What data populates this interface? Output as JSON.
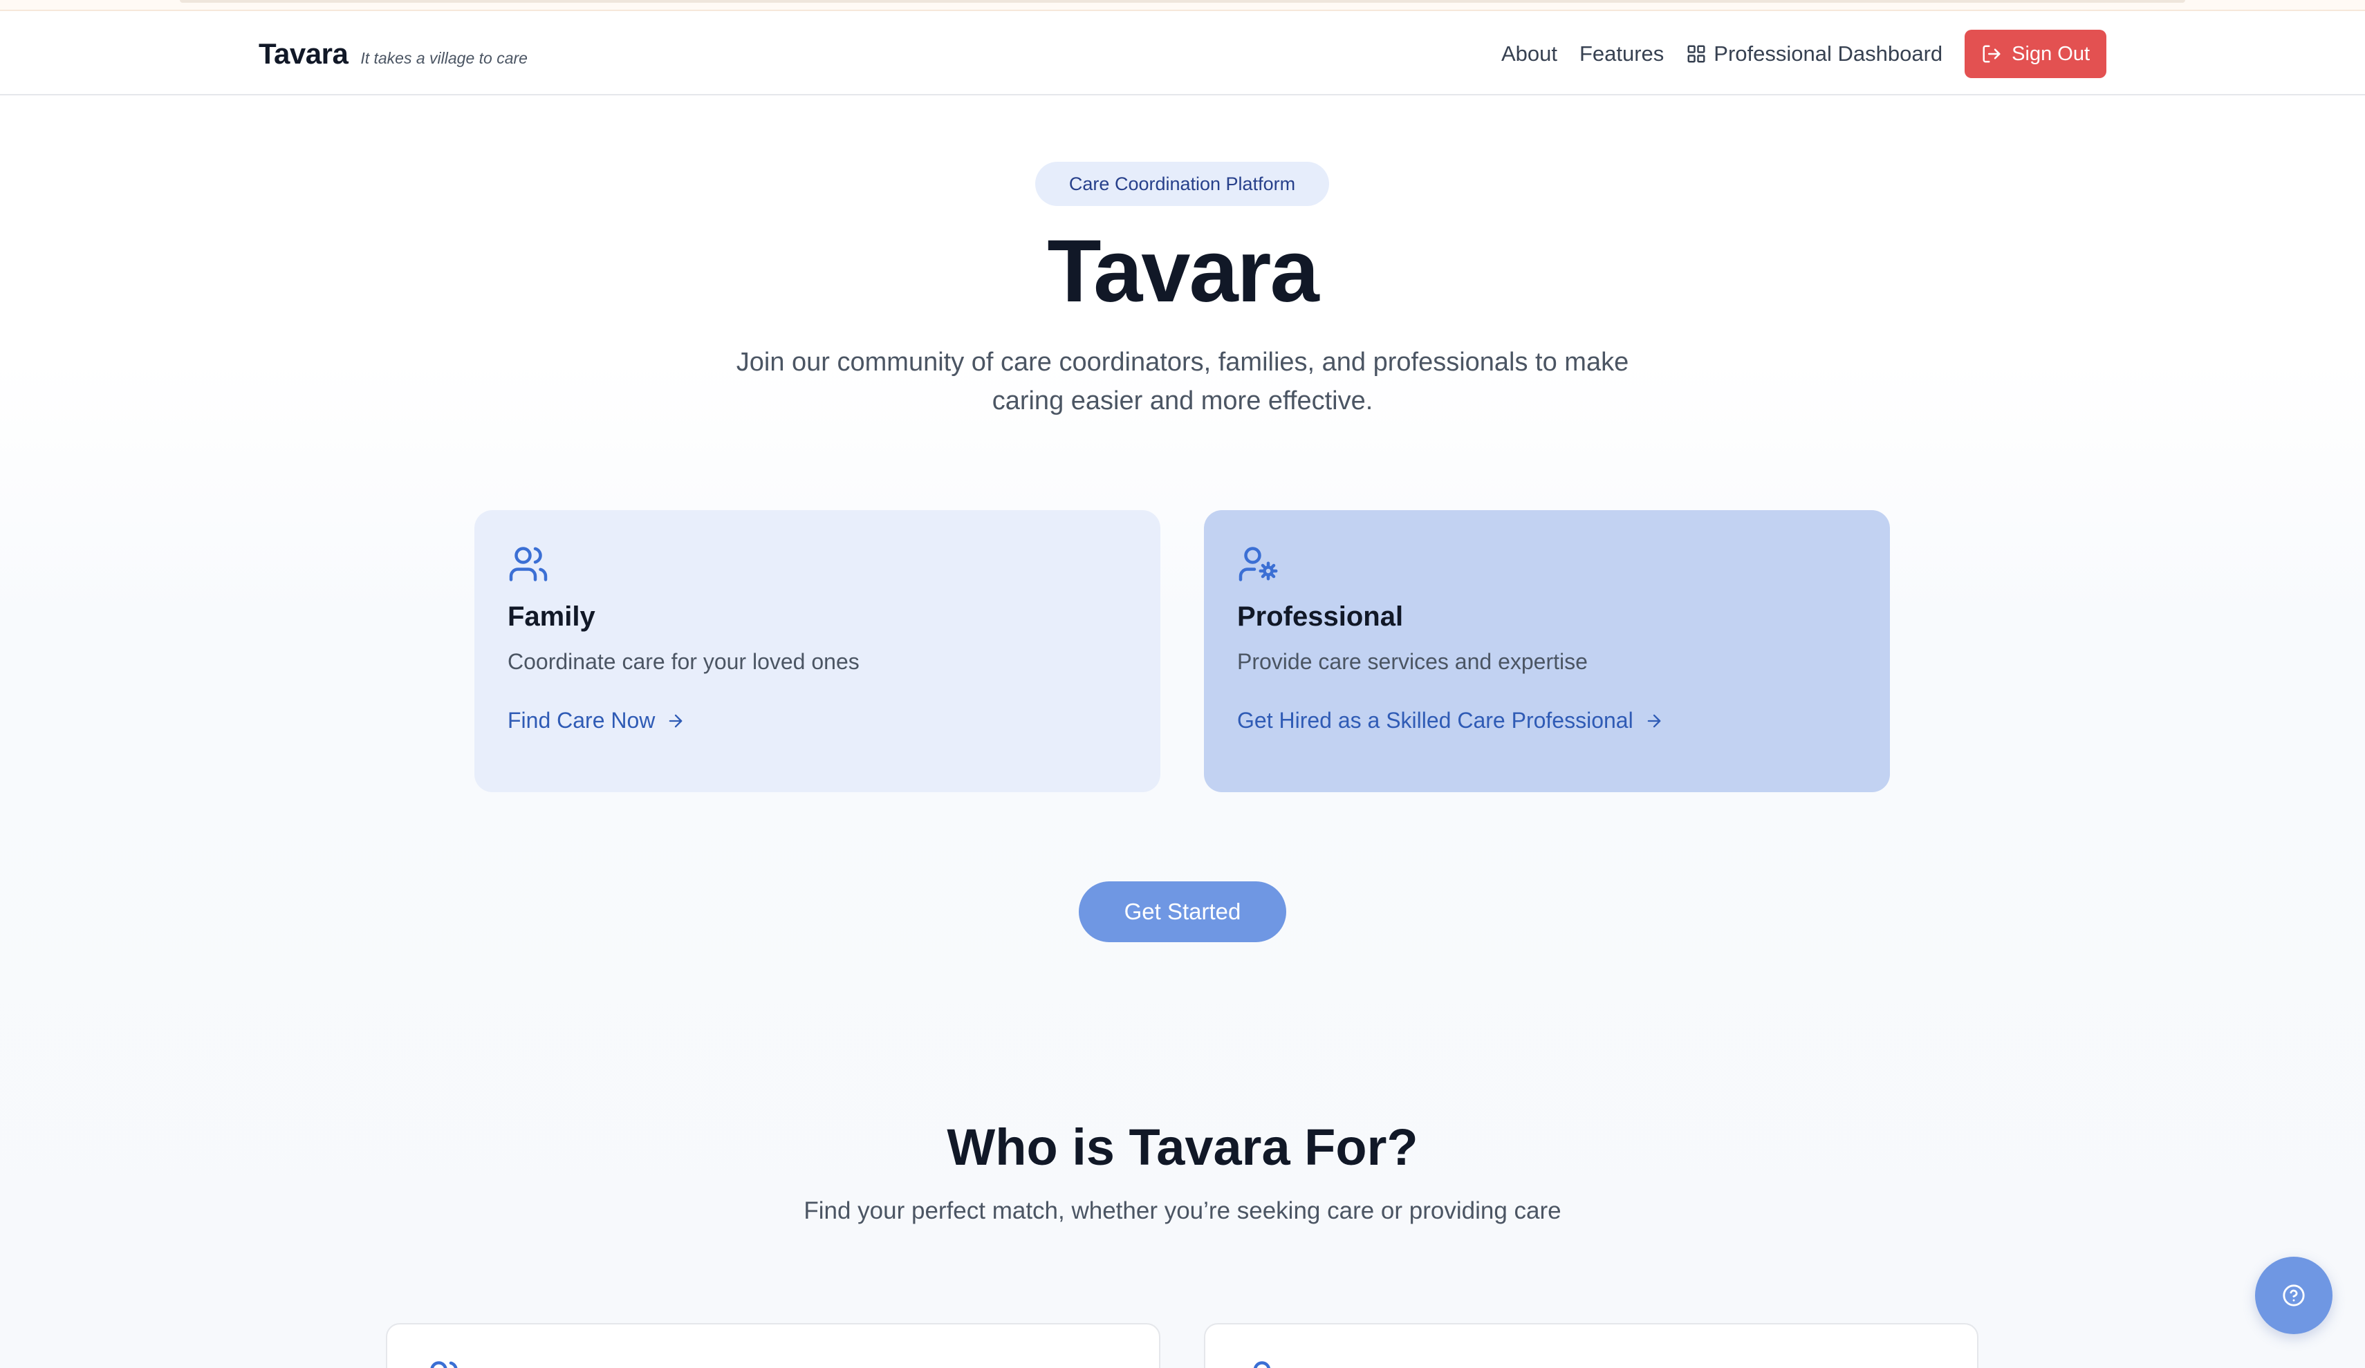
{
  "brand": {
    "name": "Tavara",
    "tagline": "It takes a village to care"
  },
  "nav": {
    "about": "About",
    "features": "Features",
    "dashboard": "Professional Dashboard",
    "sign_out": "Sign Out"
  },
  "hero": {
    "badge": "Care Coordination Platform",
    "title": "Tavara",
    "subtitle": "Join our community of care coordinators, families, and professionals to make caring easier and more effective."
  },
  "cards": [
    {
      "title": "Family",
      "description": "Coordinate care for your loved ones",
      "link": "Find Care Now",
      "icon": "users-icon"
    },
    {
      "title": "Professional",
      "description": "Provide care services and expertise",
      "link": "Get Hired as a Skilled Care Professional",
      "icon": "user-cog-icon"
    }
  ],
  "cta": {
    "get_started": "Get Started"
  },
  "who_section": {
    "title": "Who is Tavara For?",
    "subtitle": "Find your perfect match, whether you’re seeking care or providing care"
  },
  "colors": {
    "accent": "#6f97e3",
    "sign_out_bg": "#e35151",
    "family_card_bg": "#e8eefb",
    "professional_card_bg": "#c2d2f2",
    "link": "#2f5bb5"
  },
  "icons": {
    "dashboard": "layout-grid-icon",
    "sign_out": "log-out-icon",
    "arrow": "arrow-right-icon",
    "help": "help-circle-icon"
  }
}
